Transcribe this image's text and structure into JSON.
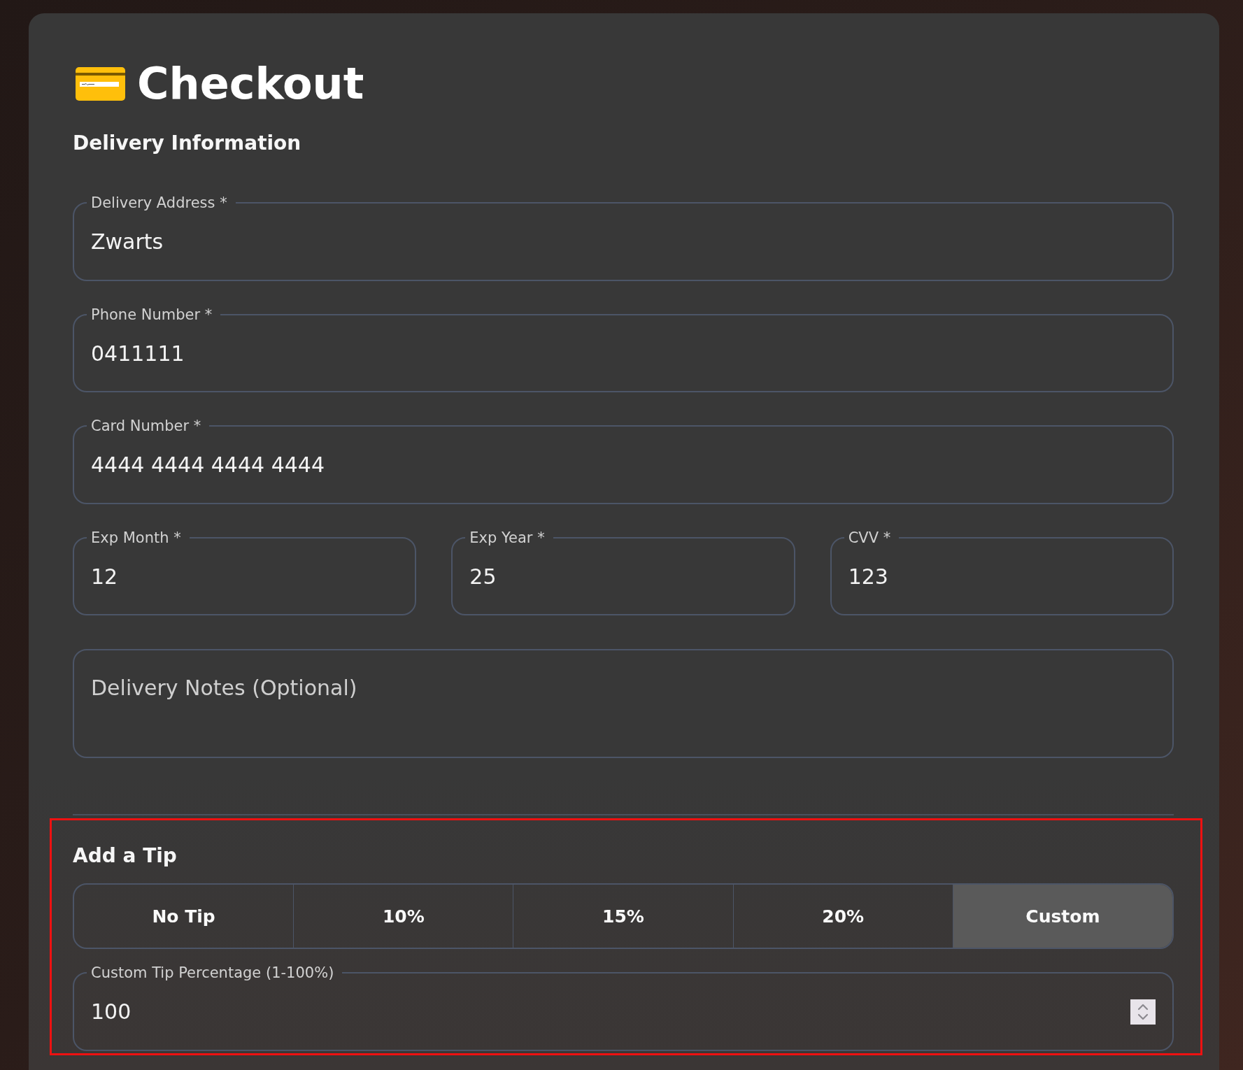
{
  "title": "Checkout",
  "delivery": {
    "heading": "Delivery Information",
    "fields": [
      {
        "label": "Delivery Address *",
        "value": "Zwarts"
      },
      {
        "label": "Phone Number *",
        "value": "0411111"
      },
      {
        "label": "Card Number *",
        "value": "4444 4444 4444 4444"
      }
    ],
    "expiry_fields": [
      {
        "label": "Exp Month *",
        "value": "12"
      },
      {
        "label": "Exp Year *",
        "value": "25"
      },
      {
        "label": "CVV *",
        "value": "123"
      }
    ],
    "notes": {
      "placeholder": "Delivery Notes (Optional)"
    }
  },
  "tip": {
    "highlighted": true,
    "heading": "Add a Tip",
    "options": [
      {
        "label": "No Tip",
        "selected": false
      },
      {
        "label": "10%",
        "selected": false
      },
      {
        "label": "15%",
        "selected": false
      },
      {
        "label": "20%",
        "selected": false
      },
      {
        "label": "Custom",
        "selected": true
      }
    ],
    "custom_field": {
      "kind": "number",
      "label": "Custom Tip Percentage (1-100%)",
      "value": "100"
    }
  }
}
